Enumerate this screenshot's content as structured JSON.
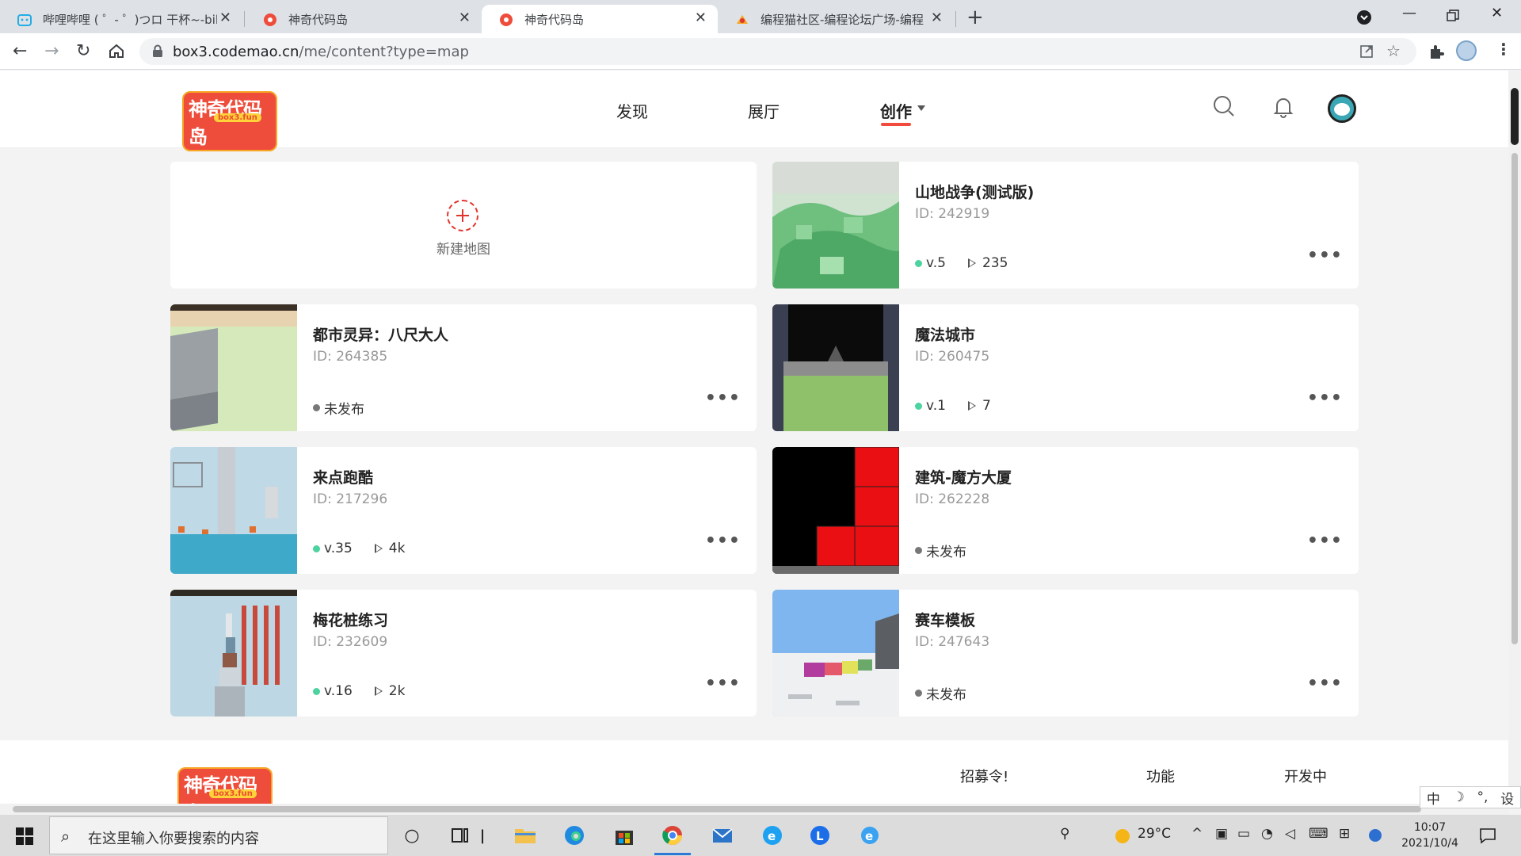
{
  "browser": {
    "tabs": [
      {
        "title": "哔哩哔哩 ( ゜- ゜)つロ 干杯~-bili",
        "active": false
      },
      {
        "title": "神奇代码岛",
        "active": false
      },
      {
        "title": "神奇代码岛",
        "active": true
      },
      {
        "title": "编程猫社区-编程论坛广场-编程",
        "active": false
      }
    ],
    "url_host": "box3.codemao.cn",
    "url_path": "/me/content?type=map"
  },
  "site": {
    "logo_text": "神奇代码岛",
    "logo_sub": "box3.fun",
    "nav": [
      {
        "label": "发现"
      },
      {
        "label": "展厅"
      },
      {
        "label": "创作"
      }
    ]
  },
  "new_map": {
    "label": "新建地图"
  },
  "maps": [
    {
      "name": "山地战争(测试版)",
      "id": "ID: 242919",
      "version": "v.5",
      "plays": "235",
      "published": true
    },
    {
      "name": "都市灵异：八尺大人",
      "id": "ID: 264385",
      "status": "未发布",
      "published": false
    },
    {
      "name": "魔法城市",
      "id": "ID: 260475",
      "version": "v.1",
      "plays": "7",
      "published": true
    },
    {
      "name": "来点跑酷",
      "id": "ID: 217296",
      "version": "v.35",
      "plays": "4k",
      "published": true
    },
    {
      "name": "建筑-魔方大厦",
      "id": "ID: 262228",
      "status": "未发布",
      "published": false
    },
    {
      "name": "梅花桩练习",
      "id": "ID: 232609",
      "version": "v.16",
      "plays": "2k",
      "published": true
    },
    {
      "name": "赛车模板",
      "id": "ID: 247643",
      "status": "未发布",
      "published": false
    }
  ],
  "footer": {
    "links": [
      "招募令!",
      "功能",
      "开发中"
    ]
  },
  "ime": {
    "items": [
      "中",
      "☽",
      "°,",
      "设"
    ]
  },
  "taskbar": {
    "search_placeholder": "在这里输入你要搜索的内容",
    "weather": "29°C",
    "time": "10:07",
    "date": "2021/10/4"
  }
}
